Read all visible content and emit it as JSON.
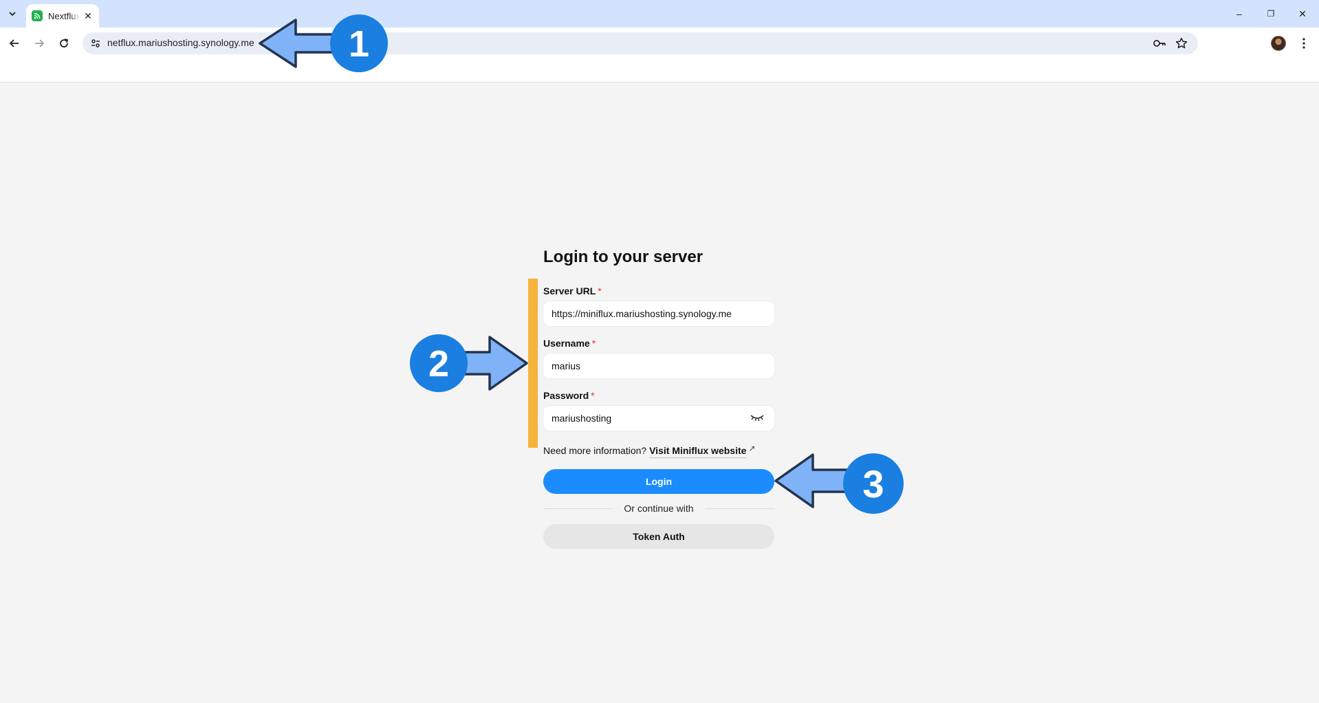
{
  "browser": {
    "tab": {
      "title": "Nextflux",
      "favicon_color": "#22b14c"
    },
    "address_bar": {
      "url": "netflux.mariushosting.synology.me"
    },
    "window_controls": {
      "minimize": "–",
      "restore": "❐",
      "close": "✕"
    },
    "icons": {
      "tab_menu": "chevron-down-icon",
      "tab_close": "close-icon",
      "back": "arrow-left-icon",
      "forward": "arrow-right-icon",
      "reload": "reload-icon",
      "site_info": "tune-icon",
      "password_key": "key-icon",
      "bookmark": "star-icon",
      "profile": "avatar",
      "menu": "kebab-icon"
    }
  },
  "login": {
    "title": "Login to your server",
    "server_url": {
      "label": "Server URL",
      "required_mark": "*",
      "value": "https://miniflux.mariushosting.synology.me"
    },
    "username": {
      "label": "Username",
      "required_mark": "*",
      "value": "marius"
    },
    "password": {
      "label": "Password",
      "required_mark": "*",
      "value": "mariushosting"
    },
    "info_text": "Need more information?",
    "info_link": "Visit Miniflux website",
    "login_button": "Login",
    "divider_text": "Or continue with",
    "token_button": "Token Auth",
    "accent_color": "#1a8cff",
    "highlight_bar_color": "#f5b33b"
  },
  "annotations": {
    "badges": [
      "1",
      "2",
      "3"
    ],
    "badge_color": "#1a7fe0",
    "arrow_fill": "#7fb2f7",
    "arrow_stroke": "#24344f"
  }
}
